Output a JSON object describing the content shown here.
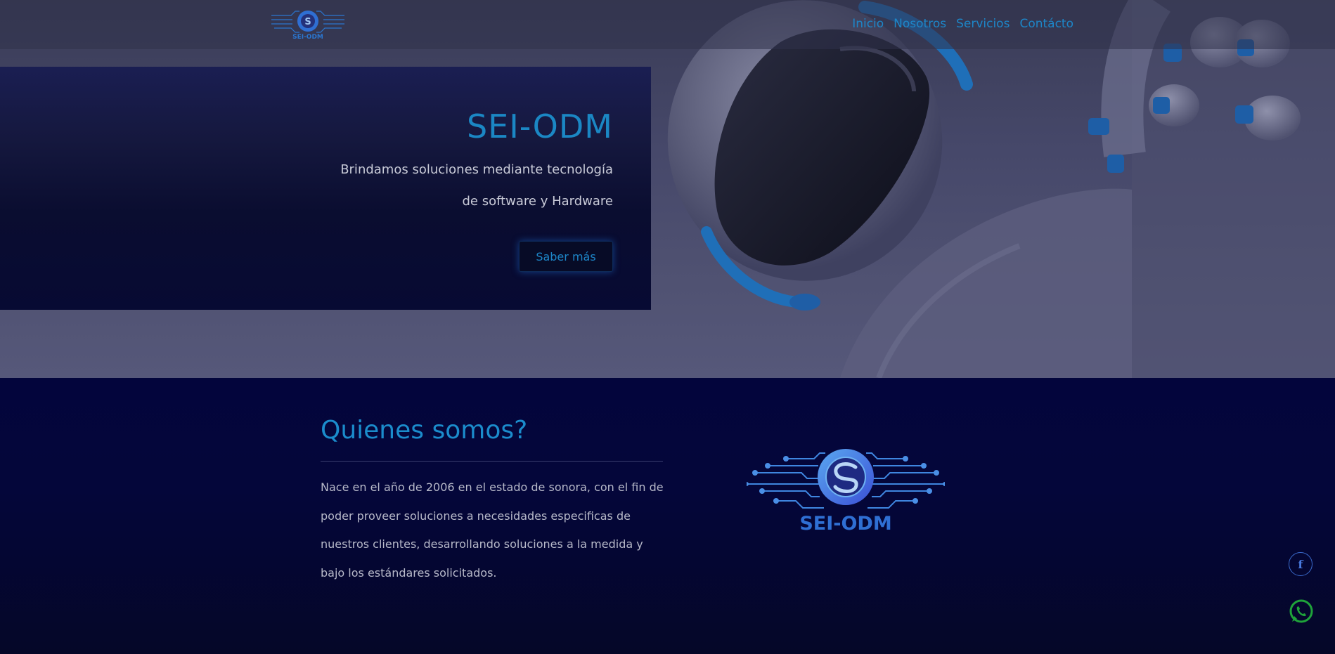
{
  "brand": {
    "name": "SEI-ODM"
  },
  "nav": {
    "items": [
      {
        "label": "Inicio"
      },
      {
        "label": "Nosotros"
      },
      {
        "label": "Servicios"
      },
      {
        "label": "Contácto"
      }
    ]
  },
  "hero": {
    "title": "SEI-ODM",
    "line1": "Brindamos soluciones mediante tecnología",
    "line2": "de software y Hardware",
    "cta_label": "Saber más"
  },
  "about": {
    "title": "Quienes somos?",
    "text": "Nace en el año de 2006 en el estado de sonora, con el fin de poder proveer soluciones a necesidades especificas de nuestros clientes, desarrollando soluciones a la medida y bajo los estándares solicitados."
  },
  "social": {
    "facebook_icon": "facebook-icon",
    "whatsapp_icon": "whatsapp-icon"
  },
  "colors": {
    "accent": "#1b87c4",
    "page_bg": "#06072a",
    "whatsapp": "#1fa33a"
  }
}
